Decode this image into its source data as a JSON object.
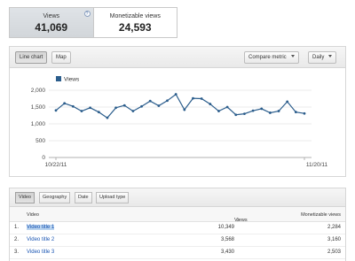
{
  "metrics": [
    {
      "label": "Views",
      "value": "41,069"
    },
    {
      "label": "Monetizable views",
      "value": "24,593"
    }
  ],
  "help_glyph": "?",
  "chart_toolbar": {
    "tabs": [
      {
        "label": "Line chart"
      },
      {
        "label": "Map"
      }
    ],
    "compare_label": "Compare metric",
    "interval_label": "Daily"
  },
  "chart_data": {
    "type": "line",
    "legend": "Views",
    "series_color": "#2b5d8c",
    "y_ticks": [
      "2,000",
      "1,500",
      "1,000",
      "500",
      "0"
    ],
    "ylim": [
      0,
      2000
    ],
    "x_start_label": "10/22/11",
    "x_end_label": "11/20/11",
    "values": [
      1400,
      1610,
      1520,
      1380,
      1480,
      1350,
      1180,
      1480,
      1550,
      1380,
      1520,
      1680,
      1540,
      1690,
      1880,
      1420,
      1760,
      1750,
      1590,
      1380,
      1500,
      1270,
      1300,
      1390,
      1450,
      1330,
      1380,
      1660,
      1350,
      1310
    ],
    "grid": true
  },
  "table_toolbar": {
    "tabs": [
      {
        "label": "Video"
      },
      {
        "label": "Geography"
      },
      {
        "label": "Date"
      },
      {
        "label": "Upload type"
      }
    ]
  },
  "table": {
    "headers": {
      "video": "Video",
      "views": "Views",
      "sort_glyph": "↓",
      "monetizable": "Monetizable views"
    },
    "rows": [
      {
        "rank": "1.",
        "title": "Video title 1",
        "views": "10,349",
        "monetizable": "2,284"
      },
      {
        "rank": "2.",
        "title": "Video title 2",
        "views": "3,568",
        "monetizable": "3,160"
      },
      {
        "rank": "3.",
        "title": "Video title 3",
        "views": "3,430",
        "monetizable": "2,503"
      }
    ]
  }
}
